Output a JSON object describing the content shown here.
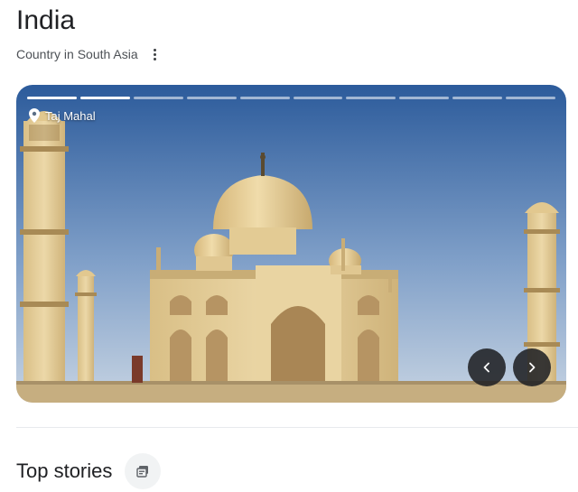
{
  "header": {
    "title": "India",
    "subtitle": "Country in South Asia",
    "more_icon": "more-vert-icon"
  },
  "carousel": {
    "location_label": "Taj Mahal",
    "location_icon": "location-pin-icon",
    "slide_count": 10,
    "slides_seen": 2,
    "prev_icon": "chevron-left-icon",
    "next_icon": "chevron-right-icon",
    "image_subject": "photo"
  },
  "top_stories": {
    "title": "Top stories",
    "icon": "stacked-cards-icon"
  },
  "colors": {
    "sky_top": "#2f5f9e",
    "sky_bottom": "#b9cbe0",
    "marble": "#e8d3a2",
    "nav_button": "#202124"
  }
}
